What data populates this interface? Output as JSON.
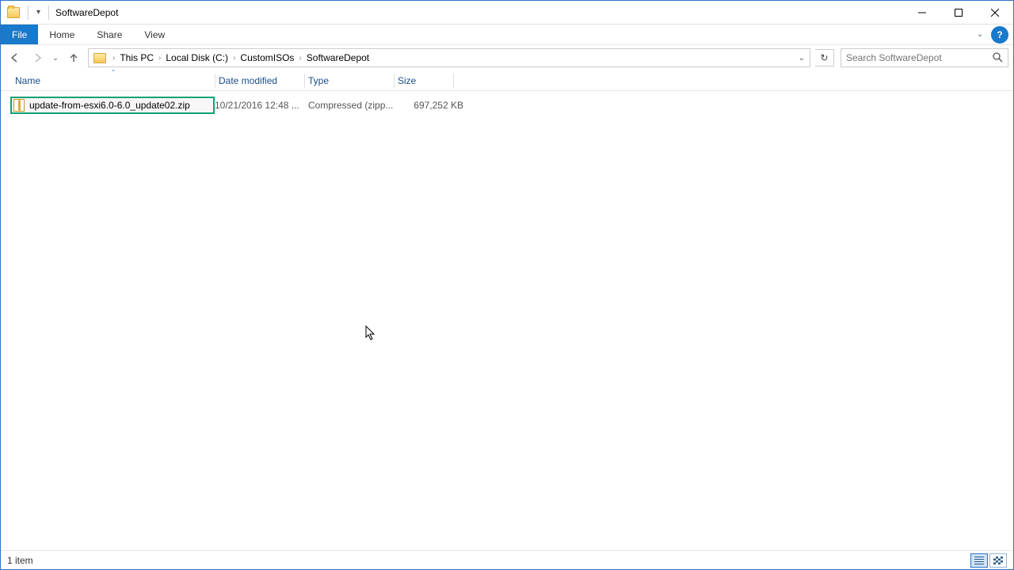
{
  "window": {
    "title": "SoftwareDepot"
  },
  "ribbon": {
    "file": "File",
    "tabs": [
      "Home",
      "Share",
      "View"
    ]
  },
  "breadcrumb": [
    "This PC",
    "Local Disk (C:)",
    "CustomISOs",
    "SoftwareDepot"
  ],
  "search": {
    "placeholder": "Search SoftwareDepot"
  },
  "columns": {
    "name": "Name",
    "date": "Date modified",
    "type": "Type",
    "size": "Size"
  },
  "files": [
    {
      "name": "update-from-esxi6.0-6.0_update02.zip",
      "date": "10/21/2016 12:48 ...",
      "type": "Compressed (zipp...",
      "size": "697,252 KB",
      "highlighted": true
    }
  ],
  "status": {
    "count": "1 item"
  }
}
